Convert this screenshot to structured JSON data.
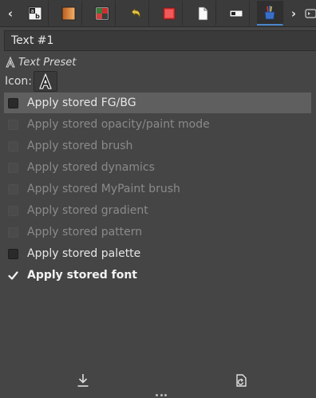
{
  "tabs": {
    "scroll_left": "‹",
    "scroll_right": "›",
    "items": [
      {
        "name": "font"
      },
      {
        "name": "gradient"
      },
      {
        "name": "palette"
      },
      {
        "name": "undo-history"
      },
      {
        "name": "pattern"
      },
      {
        "name": "document"
      },
      {
        "name": "template"
      },
      {
        "name": "tool-presets"
      }
    ]
  },
  "preset": {
    "name": "Text #1",
    "type_label": "Text Preset",
    "icon_label": "Icon:"
  },
  "options": [
    {
      "label": "Apply stored FG/BG",
      "state": "unchecked",
      "enabled": true
    },
    {
      "label": "Apply stored opacity/paint mode",
      "state": "unchecked",
      "enabled": false
    },
    {
      "label": "Apply stored brush",
      "state": "unchecked",
      "enabled": false
    },
    {
      "label": "Apply stored dynamics",
      "state": "unchecked",
      "enabled": false
    },
    {
      "label": "Apply stored MyPaint brush",
      "state": "unchecked",
      "enabled": false
    },
    {
      "label": "Apply stored gradient",
      "state": "unchecked",
      "enabled": false
    },
    {
      "label": "Apply stored pattern",
      "state": "unchecked",
      "enabled": false
    },
    {
      "label": "Apply stored palette",
      "state": "unchecked",
      "enabled": true
    },
    {
      "label": "Apply stored font",
      "state": "checked",
      "enabled": true
    }
  ],
  "bottom_buttons": [
    {
      "name": "save-preset",
      "icon": "download-icon"
    },
    {
      "name": "restore-preset",
      "icon": "restore-icon"
    }
  ]
}
